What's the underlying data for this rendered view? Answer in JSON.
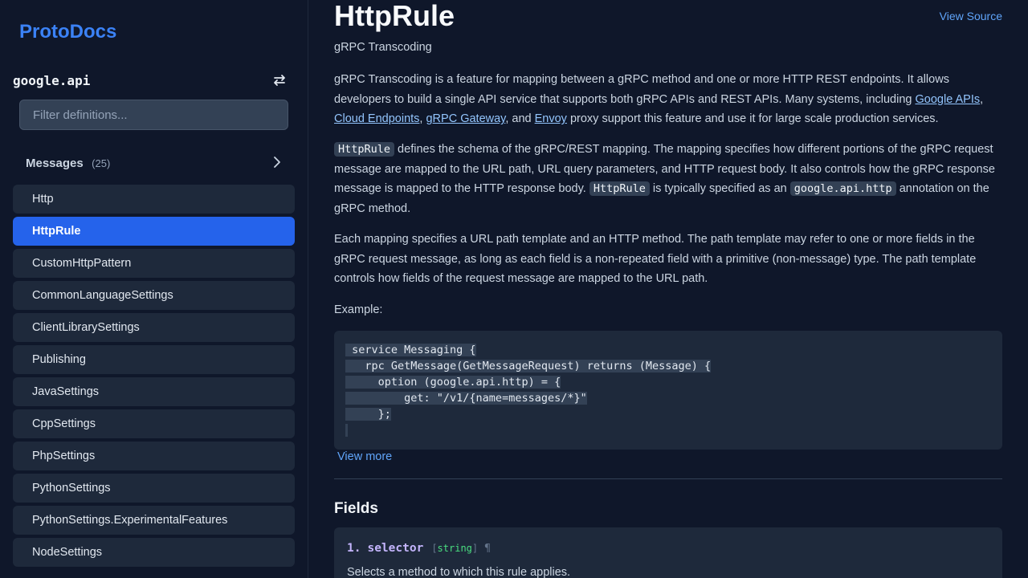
{
  "brand": "ProtoDocs",
  "package_name": "google.api",
  "filter": {
    "placeholder": "Filter definitions..."
  },
  "messages_section": {
    "title": "Messages",
    "count": "(25)"
  },
  "nav_items": [
    {
      "label": "Http",
      "active": false
    },
    {
      "label": "HttpRule",
      "active": true
    },
    {
      "label": "CustomHttpPattern",
      "active": false
    },
    {
      "label": "CommonLanguageSettings",
      "active": false
    },
    {
      "label": "ClientLibrarySettings",
      "active": false
    },
    {
      "label": "Publishing",
      "active": false
    },
    {
      "label": "JavaSettings",
      "active": false
    },
    {
      "label": "CppSettings",
      "active": false
    },
    {
      "label": "PhpSettings",
      "active": false
    },
    {
      "label": "PythonSettings",
      "active": false
    },
    {
      "label": "PythonSettings.ExperimentalFeatures",
      "active": false
    },
    {
      "label": "NodeSettings",
      "active": false
    }
  ],
  "main": {
    "title": "HttpRule",
    "view_source": "View Source",
    "subtitle": "gRPC Transcoding",
    "p1": {
      "text1": "gRPC Transcoding is a feature for mapping between a gRPC method and one or more HTTP REST endpoints. It allows developers to build a single API service that supports both gRPC APIs and REST APIs. Many systems, including ",
      "link1": "Google APIs",
      "sep1": ", ",
      "link2": "Cloud Endpoints",
      "sep2": ", ",
      "link3": "gRPC Gateway",
      "sep3": ", and ",
      "link4": "Envoy",
      "text2": " proxy support this feature and use it for large scale production services."
    },
    "p2": {
      "code1": "HttpRule",
      "text1": " defines the schema of the gRPC/REST mapping. The mapping specifies how different portions of the gRPC request message are mapped to the URL path, URL query parameters, and HTTP request body. It also controls how the gRPC response message is mapped to the HTTP response body. ",
      "code2": "HttpRule",
      "text2": " is typically specified as an ",
      "code3": "google.api.http",
      "text3": " annotation on the gRPC method."
    },
    "p3": "Each mapping specifies a URL path template and an HTTP method. The path template may refer to one or more fields in the gRPC request message, as long as each field is a non-repeated field with a primitive (non-message) type. The path template controls how fields of the request message are mapped to the URL path.",
    "example_label": "Example:",
    "code_lines": [
      " service Messaging {",
      "   rpc GetMessage(GetMessageRequest) returns (Message) {",
      "     option (google.api.http) = {",
      "         get: \"/v1/{name=messages/*}\"",
      "     };",
      ""
    ],
    "view_more": "View more",
    "fields_title": "Fields",
    "fields": [
      {
        "number": "1.",
        "name": "selector",
        "type_open": "[",
        "type": "string",
        "type_close": "]",
        "anchor": "¶",
        "description": "Selects a method to which this rule applies."
      }
    ]
  },
  "colors": {
    "accent": "#3b82f6",
    "active_item": "#2563eb",
    "link": "#60a5fa",
    "background": "#0f172a",
    "panel": "#1e293b"
  }
}
